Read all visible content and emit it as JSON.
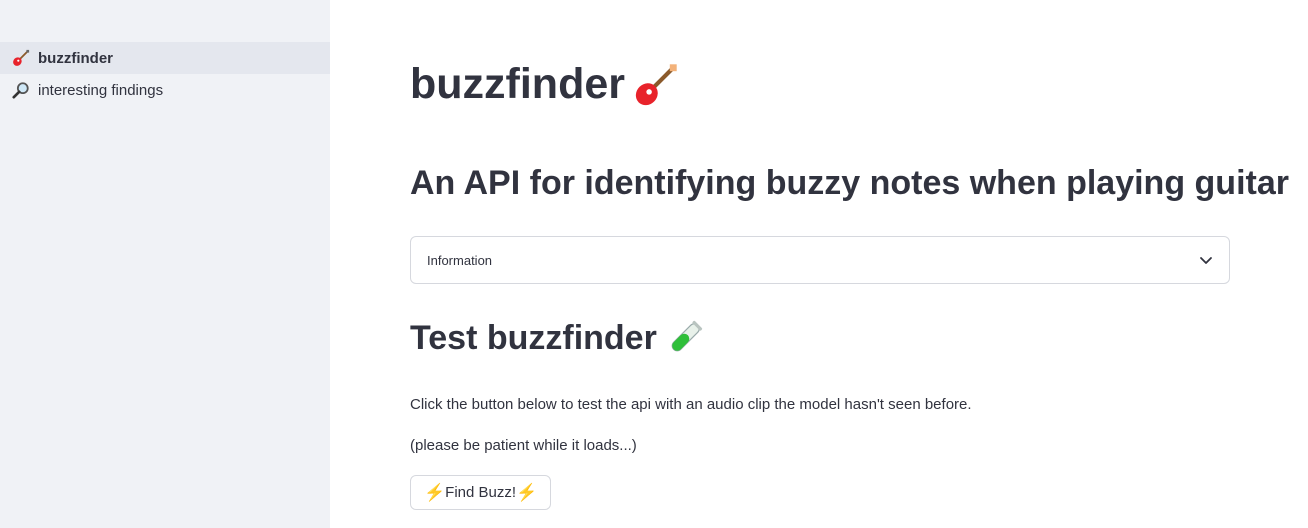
{
  "sidebar": {
    "items": [
      {
        "label": "buzzfinder",
        "icon": "guitar-icon",
        "active": true
      },
      {
        "label": "interesting findings",
        "icon": "magnifying-glass-icon",
        "active": false
      }
    ]
  },
  "main": {
    "title": "buzzfinder",
    "title_icon": "guitar-icon",
    "subtitle": "An API for identifying buzzy notes when playing guitar",
    "expander": {
      "label": "Information",
      "icon": "chevron-down-icon"
    },
    "test_heading": "Test buzzfinder",
    "test_icon": "test-tube-icon",
    "paragraph_1": "Click the button below to test the api with an audio clip the model hasn't seen before.",
    "paragraph_2": "(please be patient while it loads...)",
    "button": {
      "label": "Find Buzz!",
      "icon": "lightning-icon"
    }
  },
  "colors": {
    "sidebar_bg": "#f0f2f6",
    "active_item_bg": "#e4e7ee",
    "text": "#31333f",
    "border": "#d6d8de"
  }
}
